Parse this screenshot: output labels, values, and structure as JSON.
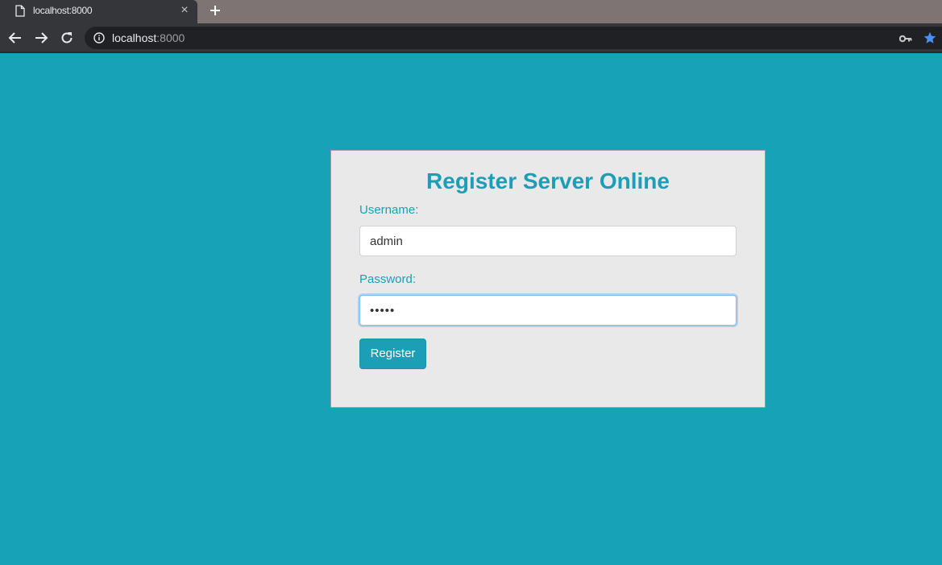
{
  "browser": {
    "tab": {
      "title": "localhost:8000",
      "favicon": "page-icon",
      "close_glyph": "×"
    },
    "new_tab_icon": "plus-icon",
    "nav": {
      "back_icon": "arrow-left-icon",
      "forward_icon": "arrow-right-icon",
      "reload_icon": "reload-icon"
    },
    "address_bar": {
      "info_icon": "info-icon",
      "host": "localhost",
      "port": ":8000",
      "key_icon": "key-icon",
      "star_icon": "star-icon",
      "star_color": "#4a8ff5"
    }
  },
  "page": {
    "background_color": "#17a2b8",
    "accent_color": "#1c9fb6",
    "title": "Register Server Online",
    "username": {
      "label": "Username:",
      "value": "admin"
    },
    "password": {
      "label": "Password:",
      "value": "admin"
    },
    "submit_label": "Register"
  }
}
